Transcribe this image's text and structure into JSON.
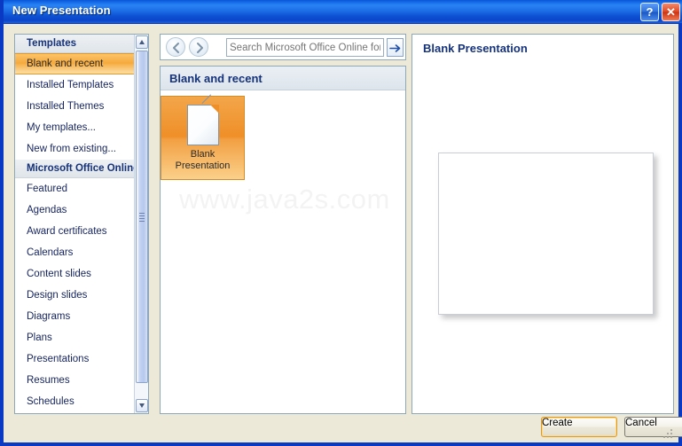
{
  "window": {
    "title": "New Presentation",
    "help_button": "?",
    "close_button": "✕"
  },
  "sidebar": {
    "groups": [
      {
        "header": "Templates",
        "items": [
          {
            "label": "Blank and recent",
            "selected": true
          },
          {
            "label": "Installed Templates",
            "selected": false
          },
          {
            "label": "Installed Themes",
            "selected": false
          },
          {
            "label": "My templates...",
            "selected": false
          },
          {
            "label": "New from existing...",
            "selected": false
          }
        ]
      },
      {
        "header": "Microsoft Office Online",
        "items": [
          {
            "label": "Featured",
            "selected": false
          },
          {
            "label": "Agendas",
            "selected": false
          },
          {
            "label": "Award certificates",
            "selected": false
          },
          {
            "label": "Calendars",
            "selected": false
          },
          {
            "label": "Content slides",
            "selected": false
          },
          {
            "label": "Design slides",
            "selected": false
          },
          {
            "label": "Diagrams",
            "selected": false
          },
          {
            "label": "Plans",
            "selected": false
          },
          {
            "label": "Presentations",
            "selected": false
          },
          {
            "label": "Resumes",
            "selected": false
          },
          {
            "label": "Schedules",
            "selected": false
          }
        ]
      }
    ]
  },
  "toolbar": {
    "back_icon": "back-arrow-icon",
    "forward_icon": "forward-arrow-icon",
    "search_placeholder": "Search Microsoft Office Online for a template",
    "search_value": "",
    "go_icon": "go-arrow-icon"
  },
  "center": {
    "header": "Blank and recent",
    "templates": [
      {
        "label": "Blank\nPresentation",
        "label_line1": "Blank",
        "label_line2": "Presentation",
        "selected": true
      }
    ]
  },
  "preview": {
    "title": "Blank Presentation"
  },
  "footer": {
    "create_label": "Create",
    "cancel_label": "Cancel"
  },
  "watermark": {
    "text": "www.java2s.com"
  },
  "colors": {
    "titlebar_blue": "#0a56d6",
    "frame_blue": "#0a39c4",
    "dialog_bg": "#ece9d8",
    "accent_orange": "#ef8f28",
    "selected_orange": "#f6a93c",
    "header_navy": "#16337a",
    "close_red": "#cc3311"
  }
}
